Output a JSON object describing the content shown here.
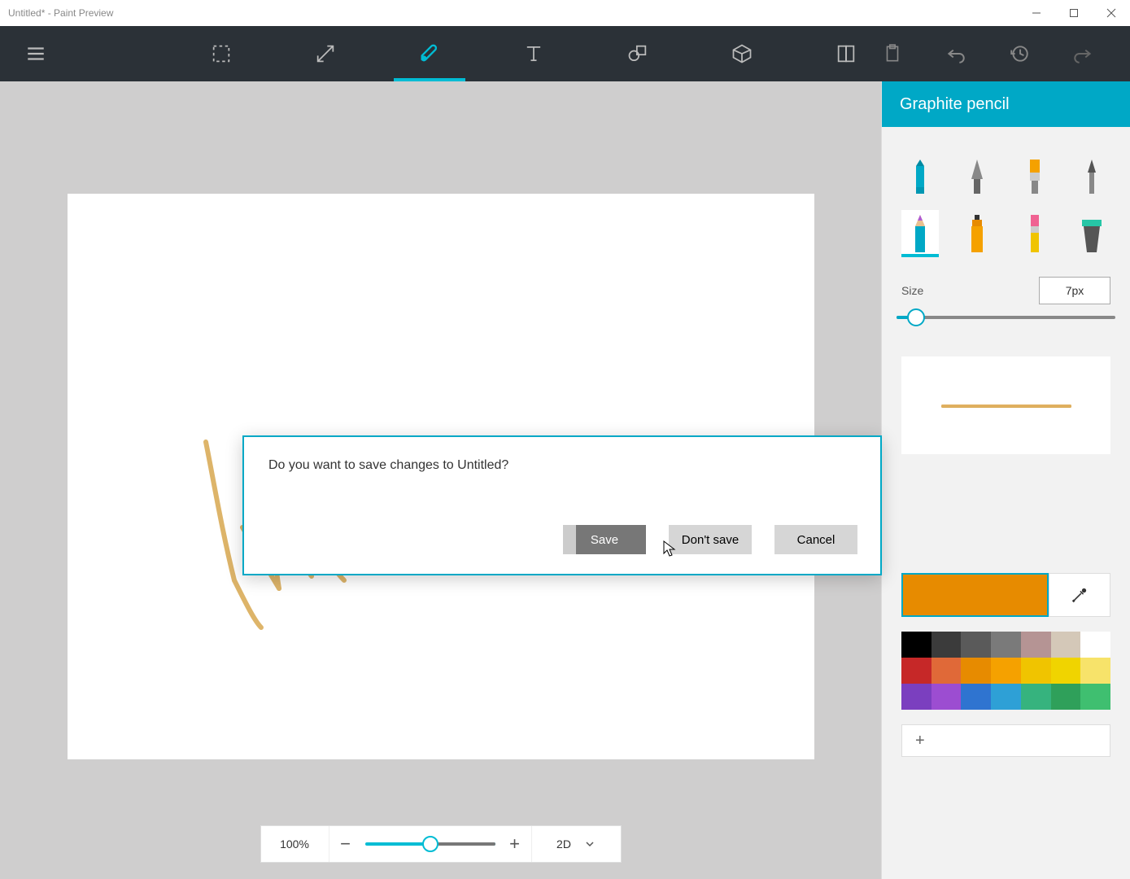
{
  "window": {
    "title": "Untitled* - Paint Preview"
  },
  "sidepanel": {
    "header": "Graphite pencil",
    "size_label": "Size",
    "size_value": "7px"
  },
  "zoombar": {
    "zoom": "100%",
    "view": "2D"
  },
  "dialog": {
    "message": "Do you want to save changes to Untitled?",
    "save": "Save",
    "dont_save": "Don't save",
    "cancel": "Cancel"
  },
  "colors": {
    "current": "#e78b00",
    "palette": [
      "#000000",
      "#3b3b3b",
      "#5a5a5a",
      "#7a7a7a",
      "#b59494",
      "#d4c8b8",
      "#ffffff",
      "#c62828",
      "#e06938",
      "#e78b00",
      "#f5a100",
      "#f0c400",
      "#f0d400",
      "#f7e36a",
      "#7b3fbf",
      "#9c4dd1",
      "#2f74d0",
      "#2ea0d6",
      "#36b37e",
      "#2fa05a",
      "#3fbf70"
    ]
  }
}
